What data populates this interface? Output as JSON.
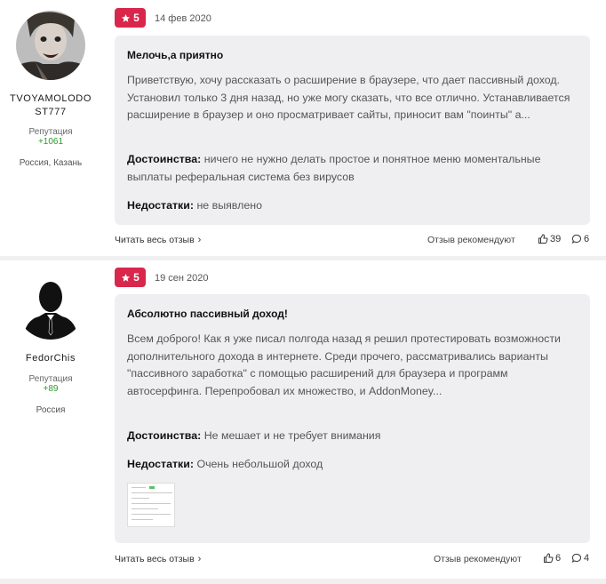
{
  "reviews": [
    {
      "author": "TVOYAMOLODO ST777",
      "reputation_label": "Репутация",
      "reputation_value": "+1061",
      "city": "Россия, Казань",
      "rating": "5",
      "date": "14 фев 2020",
      "title": "Мелочь,а приятно",
      "text": "Приветствую, хочу рассказать о расширение в браузере, что дает пассивный доход. Установил только 3 дня назад, но уже могу сказать, что все отлично. Устанавливается расширение в браузер и оно просматривает сайты, приносит вам \"поинты\" а...",
      "pros_label": "Достоинства:",
      "pros": "ничего не нужно делать простое и понятное меню моментальные выплаты реферальная система без вирусов",
      "cons_label": "Недостатки:",
      "cons": "не выявлено",
      "read_all": "Читать весь отзыв",
      "recommend": "Отзыв рекомендуют",
      "likes": "39",
      "comments": "6"
    },
    {
      "author": "FedorChis",
      "reputation_label": "Репутация",
      "reputation_value": "+89",
      "city": "Россия",
      "rating": "5",
      "date": "19 сен 2020",
      "title": "Абсолютно пассивный доход!",
      "text": "Всем доброго! Как я уже писал полгода назад я решил протестировать возможности дополнительного дохода в интернете. Среди прочего, рассматривались варианты \"пассивного заработка\" с помощью расширений для браузера и программ автосерфинга. Перепробовал их множество, и AddonMoney...",
      "pros_label": "Достоинства:",
      "pros": "Не мешает и не требует внимания",
      "cons_label": "Недостатки:",
      "cons": "Очень небольшой доход",
      "read_all": "Читать весь отзыв",
      "recommend": "Отзыв рекомендуют",
      "likes": "6",
      "comments": "4"
    }
  ],
  "colors": {
    "badge": "#d9264b",
    "reputation": "#2c9a2c",
    "card_bg": "#efeff1"
  },
  "icons": [
    "star-icon",
    "thumbs-up-icon",
    "comment-icon",
    "chevron-right-icon"
  ]
}
